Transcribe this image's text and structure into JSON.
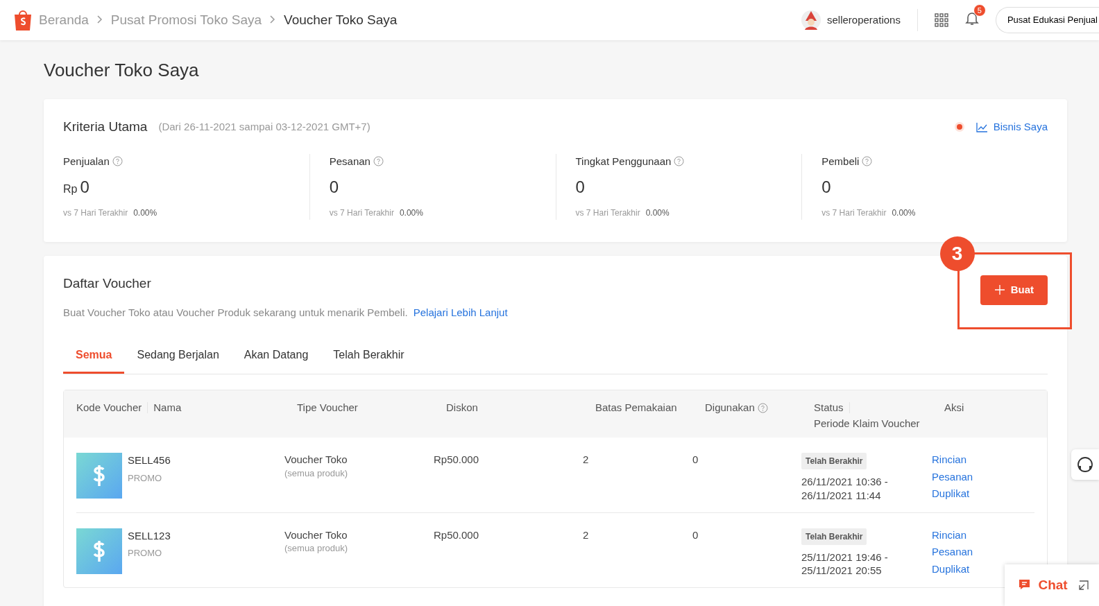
{
  "breadcrumb": [
    {
      "label": "Beranda",
      "current": false
    },
    {
      "label": "Pusat Promosi Toko Saya",
      "current": false
    },
    {
      "label": "Voucher Toko Saya",
      "current": true
    }
  ],
  "topbar": {
    "username": "selleroperations",
    "notification_count": "5",
    "edu_button": "Pusat Edukasi Penjual"
  },
  "page_title": "Voucher Toko Saya",
  "criteria": {
    "title": "Kriteria Utama",
    "period": "(Dari 26-11-2021 sampai 03-12-2021 GMT+7)",
    "link": "Bisnis Saya",
    "metrics": [
      {
        "label": "Penjualan",
        "prefix": "Rp",
        "value": "0",
        "compare_label": "vs 7 Hari Terakhir",
        "compare_value": "0.00%"
      },
      {
        "label": "Pesanan",
        "value": "0",
        "compare_label": "vs 7 Hari Terakhir",
        "compare_value": "0.00%"
      },
      {
        "label": "Tingkat Penggunaan",
        "value": "0",
        "compare_label": "vs 7 Hari Terakhir",
        "compare_value": "0.00%"
      },
      {
        "label": "Pembeli",
        "value": "0",
        "compare_label": "vs 7 Hari Terakhir",
        "compare_value": "0.00%"
      }
    ]
  },
  "voucher_list": {
    "title": "Daftar Voucher",
    "description": "Buat Voucher Toko atau Voucher Produk sekarang untuk menarik Pembeli.",
    "learn_link": "Pelajari Lebih Lanjut",
    "create_button": "Buat",
    "step_marker": "3",
    "tabs": [
      {
        "label": "Semua",
        "selected": true
      },
      {
        "label": "Sedang Berjalan",
        "selected": false
      },
      {
        "label": "Akan Datang",
        "selected": false
      },
      {
        "label": "Telah Berakhir",
        "selected": false
      }
    ],
    "columns": [
      {
        "label": "Kode Voucher",
        "label_2": "Nama"
      },
      {
        "label": "Tipe Voucher"
      },
      {
        "label": "Diskon"
      },
      {
        "label": "Batas Pemakaian"
      },
      {
        "label": "Digunakan",
        "help": true
      },
      {
        "label": "Status",
        "label_2": "Periode Klaim Voucher"
      },
      {
        "label": "Aksi"
      }
    ],
    "rows": [
      {
        "code": "SELL456",
        "name": "PROMO",
        "type": "Voucher Toko",
        "scope": "(semua produk)",
        "discount": "Rp50.000",
        "limit": "2",
        "used": "0",
        "status": "Telah Berakhir",
        "period_start": "26/11/2021 10:36 -",
        "period_end": "26/11/2021 11:44",
        "actions": [
          "Rincian",
          "Pesanan",
          "Duplikat"
        ]
      },
      {
        "code": "SELL123",
        "name": "PROMO",
        "type": "Voucher Toko",
        "scope": "(semua produk)",
        "discount": "Rp50.000",
        "limit": "2",
        "used": "0",
        "status": "Telah Berakhir",
        "period_start": "25/11/2021 19:46 -",
        "period_end": "25/11/2021 20:55",
        "actions": [
          "Rincian",
          "Pesanan",
          "Duplikat"
        ]
      }
    ]
  },
  "chat_widget": {
    "label": "Chat"
  }
}
